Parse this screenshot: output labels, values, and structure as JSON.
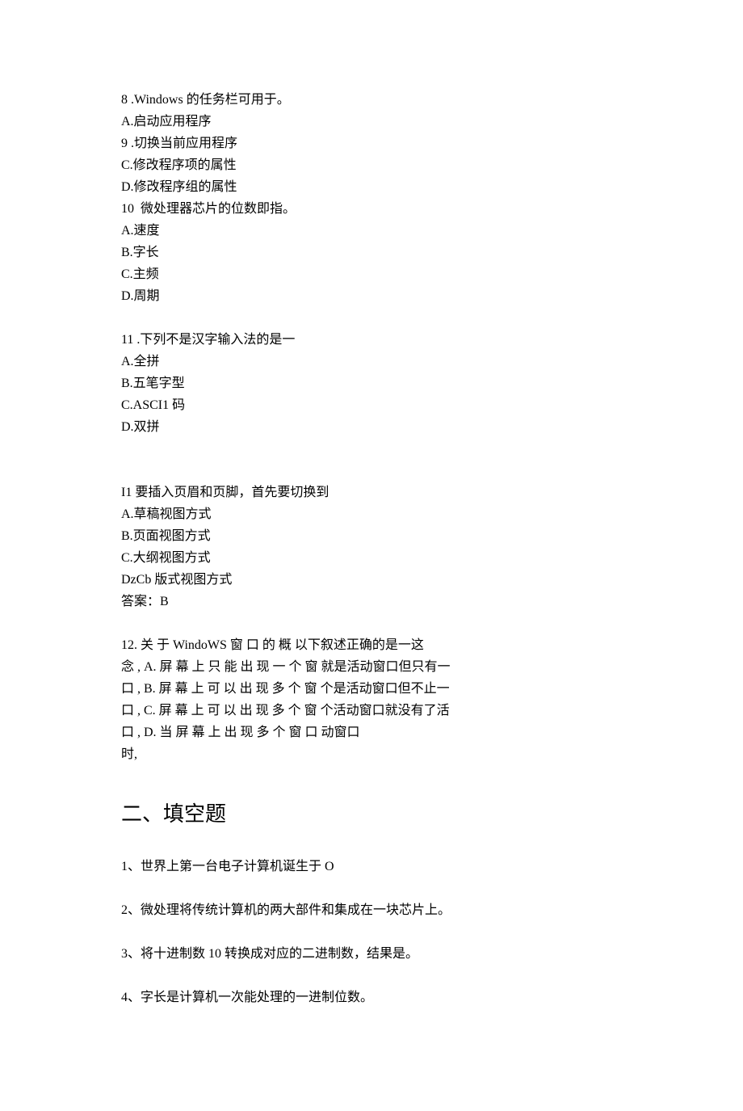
{
  "q8": {
    "num": "8",
    "stem": " .Windows 的任务栏可用于。",
    "a": "A.启动应用程序",
    "b_num": "9",
    "b": " .切换当前应用程序",
    "c": "C.修改程序项的属性",
    "d": "D.修改程序组的属性"
  },
  "q10": {
    "num": "10",
    "stem": "  微处理器芯片的位数即指。",
    "a": "A.速度",
    "b": "B.字长",
    "c": "C.主频",
    "d": "D.周期"
  },
  "q11": {
    "num": "11",
    "stem": " .下列不是汉字输入法的是一",
    "a": "A.全拼",
    "b": "B.五笔字型",
    "c": "C.ASCI1 码",
    "d": "D.双拼"
  },
  "qI1": {
    "stem": "I1 要插入页眉和页脚，首先要切换到",
    "a": "A.草稿视图方式",
    "b": "B.页面视图方式",
    "c": "C.大纲视图方式",
    "d": "DzCb 版式视图方式",
    "ans": "答案：B"
  },
  "q12": {
    "l1": "12. 关 于 WindoWS 窗 口 的 概 以下叙述正确的是一这",
    "l2": "念 , A. 屏 幕 上 只 能 出 现 一 个 窗 就是活动窗口但只有一",
    "l3": "口 , B. 屏 幕 上 可 以 出 现 多 个 窗 个是活动窗口但不止一",
    "l4": "口 , C. 屏 幕 上 可 以 出 现 多 个 窗 个活动窗口就没有了活",
    "l5": "口 , D. 当 屏 幕 上 出 现 多 个 窗 口 动窗口",
    "l6": "时,"
  },
  "section2_title": "二、填空题",
  "fill": {
    "f1": "1、世界上第一台电子计算机诞生于 O",
    "f2": "2、微处理将传统计算机的两大部件和集成在一块芯片上。",
    "f3": "3、将十进制数 10 转换成对应的二进制数，结果是。",
    "f4": "4、字长是计算机一次能处理的一进制位数。"
  }
}
